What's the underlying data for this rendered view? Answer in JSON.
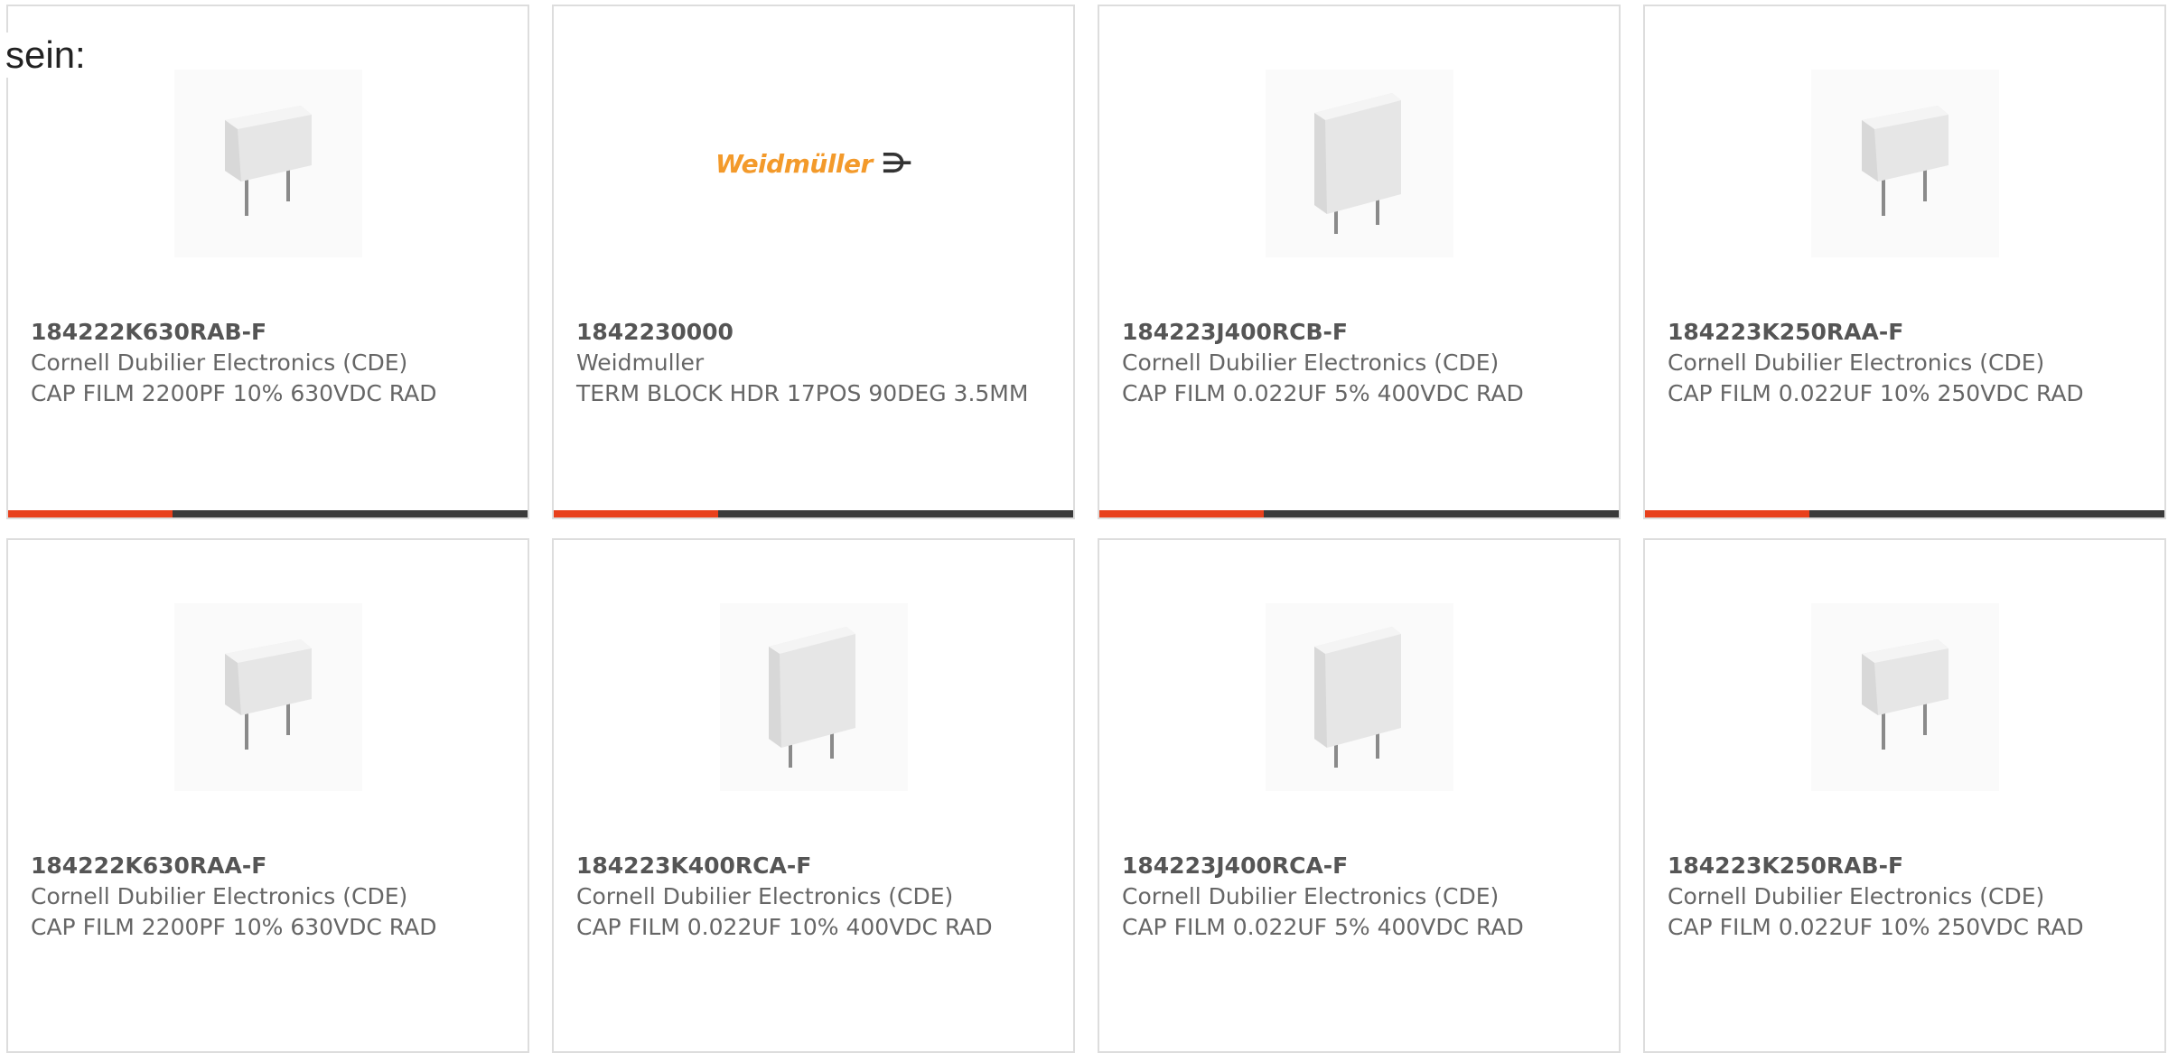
{
  "intro_text": "sein:",
  "colors": {
    "accent": "#e8401c",
    "bar": "#3a3a3a",
    "logo": "#f39a2b"
  },
  "products": [
    {
      "part_number": "184222K630RAB-F",
      "manufacturer": "Cornell Dubilier Electronics (CDE)",
      "description": "CAP FILM 2200PF 10% 630VDC RAD",
      "image": "small-film-capacitor"
    },
    {
      "part_number": "1842230000",
      "manufacturer": "Weidmuller",
      "description": "TERM BLOCK HDR 17POS 90DEG 3.5MM",
      "image": "weidmuller-logo",
      "logo_text": "Weidmüller",
      "logo_mark": "⋺"
    },
    {
      "part_number": "184223J400RCB-F",
      "manufacturer": "Cornell Dubilier Electronics (CDE)",
      "description": "CAP FILM 0.022UF 5% 400VDC RAD",
      "image": "large-film-capacitor"
    },
    {
      "part_number": "184223K250RAA-F",
      "manufacturer": "Cornell Dubilier Electronics (CDE)",
      "description": "CAP FILM 0.022UF 10% 250VDC RAD",
      "image": "small-film-capacitor"
    },
    {
      "part_number": "184222K630RAA-F",
      "manufacturer": "Cornell Dubilier Electronics (CDE)",
      "description": "CAP FILM 2200PF 10% 630VDC RAD",
      "image": "small-film-capacitor"
    },
    {
      "part_number": "184223K400RCA-F",
      "manufacturer": "Cornell Dubilier Electronics (CDE)",
      "description": "CAP FILM 0.022UF 10% 400VDC RAD",
      "image": "large-film-capacitor"
    },
    {
      "part_number": "184223J400RCA-F",
      "manufacturer": "Cornell Dubilier Electronics (CDE)",
      "description": "CAP FILM 0.022UF 5% 400VDC RAD",
      "image": "large-film-capacitor"
    },
    {
      "part_number": "184223K250RAB-F",
      "manufacturer": "Cornell Dubilier Electronics (CDE)",
      "description": "CAP FILM 0.022UF 10% 250VDC RAD",
      "image": "small-film-capacitor"
    }
  ]
}
